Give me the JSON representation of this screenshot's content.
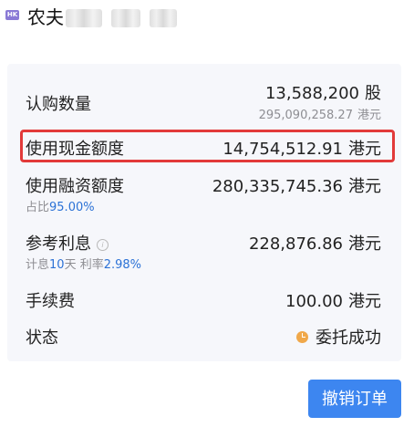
{
  "header": {
    "market_badge": "HK",
    "stock_name": "农夫"
  },
  "details": {
    "subscribe_qty": {
      "label": "认购数量",
      "value": "13,588,200",
      "unit": "股",
      "sub_value": "295,090,258.27",
      "sub_unit": "港元"
    },
    "cash_amount": {
      "label": "使用现金额度",
      "value": "14,754,512.91",
      "unit": "港元"
    },
    "financing_amount": {
      "label": "使用融资额度",
      "value": "280,335,745.36",
      "unit": "港元",
      "ratio_prefix": "占比",
      "ratio_value": "95.00%"
    },
    "interest": {
      "label": "参考利息",
      "value": "228,876.86",
      "unit": "港元",
      "days_prefix": "计息",
      "days_value": "10",
      "days_suffix": "天",
      "rate_prefix": "利率",
      "rate_value": "2.98%"
    },
    "fee": {
      "label": "手续费",
      "value": "100.00",
      "unit": "港元"
    },
    "status": {
      "label": "状态",
      "value": "委托成功"
    }
  },
  "actions": {
    "cancel_label": "撤销订单"
  },
  "colors": {
    "accent": "#3d86f0",
    "highlight_box": "#e23a3a",
    "ratio_text": "#2c72d6",
    "status_icon": "#f0a84a"
  }
}
